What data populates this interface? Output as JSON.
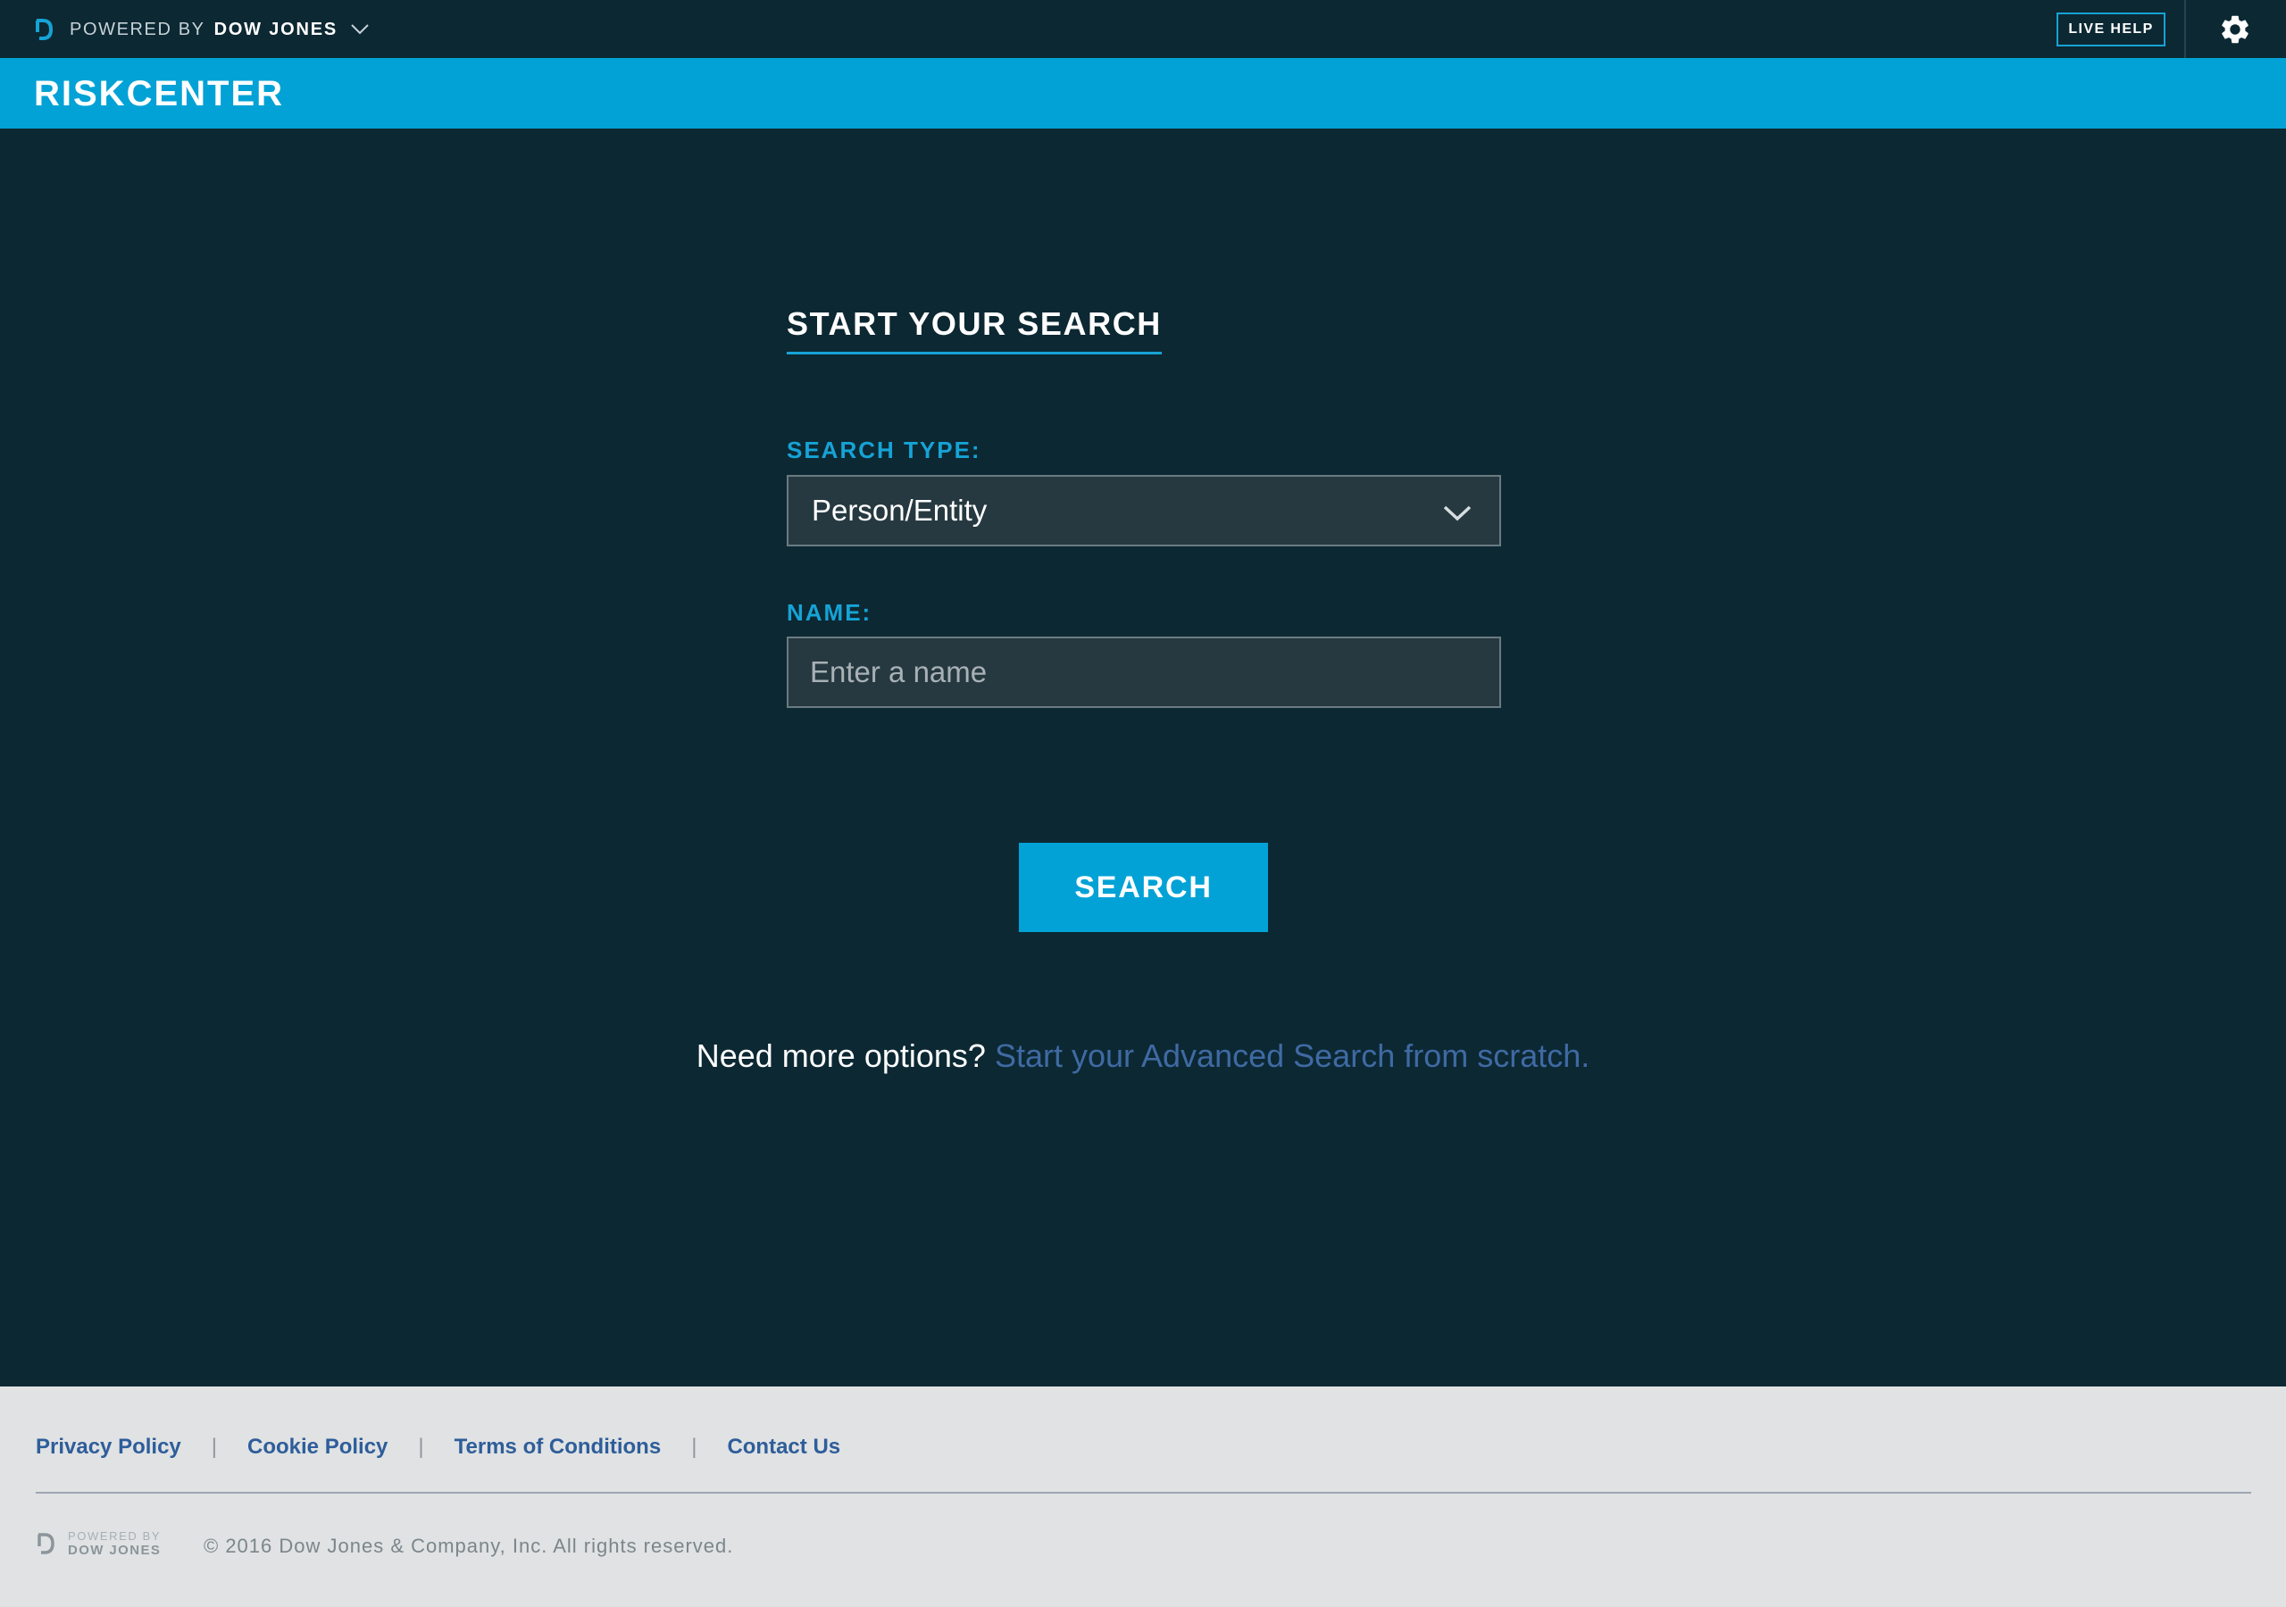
{
  "header": {
    "powered_by": "POWERED BY",
    "company": "DOW JONES",
    "live_help": "LIVE HELP"
  },
  "app": {
    "title": "RISKCENTER"
  },
  "search": {
    "heading": "START YOUR SEARCH",
    "type_label": "SEARCH TYPE:",
    "type_value": "Person/Entity",
    "name_label": "NAME:",
    "name_placeholder": "Enter a name",
    "name_value": "",
    "button": "SEARCH",
    "more_question": "Need more options?",
    "more_link": "Start your Advanced Search from scratch."
  },
  "footer": {
    "links": [
      "Privacy Policy",
      "Cookie Policy",
      "Terms of Conditions",
      "Contact Us"
    ],
    "separator": "|",
    "logo_powered": "POWERED BY",
    "logo_company": "DOW JONES",
    "copyright": "© 2016 Dow Jones & Company, Inc. All rights reserved."
  },
  "icons": {
    "brand": "dow-jones-logo-icon",
    "brand_menu": "chevron-down-icon",
    "settings": "gear-icon",
    "select": "chevron-down-icon"
  },
  "colors": {
    "background": "#0c2833",
    "accent": "#02a2d6",
    "label": "#16a3d6",
    "link": "#3f6aa3",
    "footer_bg": "#e0e2e3",
    "footer_link": "#2e5d9a"
  }
}
